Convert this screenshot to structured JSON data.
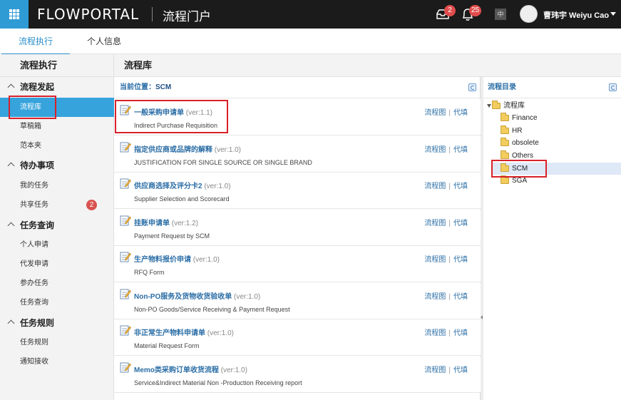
{
  "header": {
    "brand": "FLOWPORTAL",
    "portal_title": "流程门户",
    "tray_badge": "2",
    "bell_badge": "25",
    "lang": "中",
    "user_name": "曹玮宇 Weiyu Cao"
  },
  "tabs": [
    {
      "label": "流程执行",
      "active": true
    },
    {
      "label": "个人信息",
      "active": false
    }
  ],
  "sidebar": {
    "title": "流程执行",
    "groups": [
      {
        "label": "流程发起",
        "items": [
          "流程库",
          "草稿箱",
          "范本夹"
        ]
      },
      {
        "label": "待办事项",
        "items": [
          "我的任务",
          "共享任务"
        ]
      },
      {
        "label": "任务查询",
        "items": [
          "个人申请",
          "代发申请",
          "参办任务",
          "任务查询"
        ]
      },
      {
        "label": "任务规则",
        "items": [
          "任务规则",
          "通知接收"
        ]
      }
    ],
    "active_item": "流程库",
    "shared_task_badge": "2"
  },
  "content": {
    "title": "流程库",
    "location_label": "当前位置：",
    "location_value": "SCM",
    "link_flowchart": "流程图",
    "link_proxy": "代填",
    "processes": [
      {
        "name": "一般采购申请单",
        "version": "(ver:1.1)",
        "subtitle": "Indirect Purchase Requisition"
      },
      {
        "name": "指定供应商或品牌的解释",
        "version": "(ver:1.0)",
        "subtitle": "JUSTIFICATION FOR SINGLE SOURCE OR SINGLE BRAND"
      },
      {
        "name": "供应商选择及评分卡2",
        "version": "(ver:1.0)",
        "subtitle": "Supplier Selection and Scorecard"
      },
      {
        "name": "挂账申请单",
        "version": "(ver:1.2)",
        "subtitle": "Payment Request by SCM"
      },
      {
        "name": "生产物料报价申请",
        "version": "(ver:1.0)",
        "subtitle": "RFQ Form"
      },
      {
        "name": "Non-PO服务及货物收货验收单",
        "version": "(ver:1.0)",
        "subtitle": "Non-PO Goods/Service Receiving & Payment Request"
      },
      {
        "name": "非正常生产物料申请单",
        "version": "(ver:1.0)",
        "subtitle": "Material Request Form"
      },
      {
        "name": "Memo类采购订单收货流程",
        "version": "(ver:1.0)",
        "subtitle": "Service&Indirect Material Non -Production Receiving report"
      }
    ]
  },
  "tree": {
    "title": "流程目录",
    "root": "流程库",
    "children": [
      "Finance",
      "HR",
      "obsolete",
      "Others",
      "SCM",
      "SGA"
    ],
    "selected": "SCM"
  },
  "colors": {
    "accent": "#2b8fcb",
    "active_item_bg": "#36a3dc",
    "highlight_box": "#d9212a",
    "link": "#2b6ea6"
  }
}
